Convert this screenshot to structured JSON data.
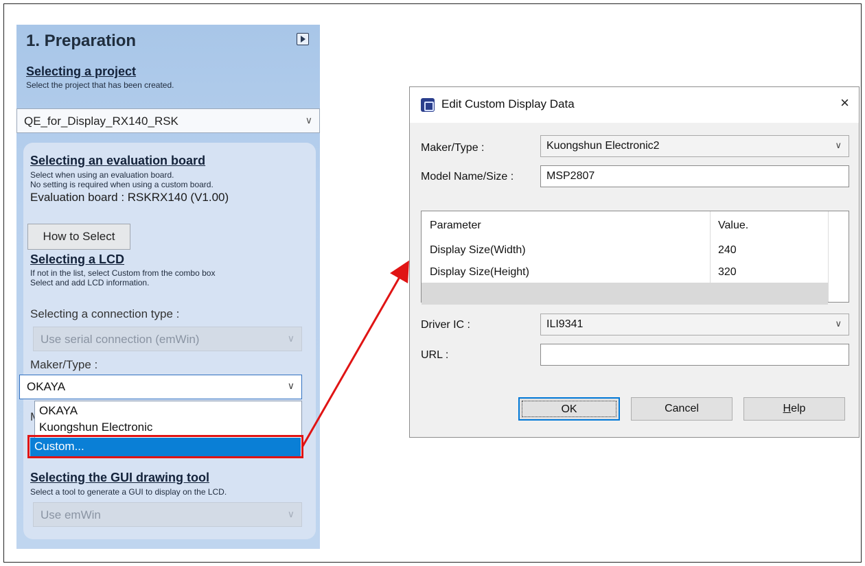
{
  "panel": {
    "title": "1. Preparation",
    "project": {
      "heading": "Selecting a project",
      "description": "Select the project that has been created.",
      "selected": "QE_for_Display_RX140_RSK"
    },
    "board": {
      "heading": "Selecting an evaluation board",
      "description_line1": "Select when using an evaluation board.",
      "description_line2": "No setting is required when using a custom board.",
      "info": "Evaluation board : RSKRX140 (V1.00)",
      "how_to_select": "How to Select"
    },
    "lcd": {
      "heading": "Selecting a LCD",
      "description_line1": "If not in the list, select Custom from the combo box",
      "description_line2": "Select and add LCD information.",
      "connection_label": "Selecting a connection type :",
      "connection_value": "Use serial connection (emWin)",
      "maker_label": "Maker/Type :",
      "maker_value": "OKAYA",
      "dropdown_options": [
        "OKAYA",
        "Kuongshun Electronic",
        "Custom..."
      ],
      "hidden_label_fragment": "M"
    },
    "gui": {
      "heading": "Selecting the GUI drawing tool",
      "description": "Select a tool to generate a GUI to display on the LCD.",
      "value": "Use emWin"
    }
  },
  "dialog": {
    "title": "Edit Custom Display Data",
    "close": "×",
    "maker_label": "Maker/Type :",
    "maker_value": "Kuongshun Electronic2",
    "model_label": "Model Name/Size :",
    "model_value": "MSP2807",
    "table": {
      "headers": [
        "Parameter",
        "Value."
      ],
      "rows": [
        {
          "parameter": "Display Size(Width)",
          "value": "240"
        },
        {
          "parameter": "Display Size(Height)",
          "value": "320"
        }
      ]
    },
    "driver_label": "Driver IC :",
    "driver_value": "ILI9341",
    "url_label": "URL :",
    "url_value": "",
    "buttons": {
      "ok": "OK",
      "cancel": "Cancel",
      "help_underlined": "H",
      "help_rest": "elp"
    }
  },
  "colors": {
    "highlight": "#e01414",
    "selection": "#0a7fd6",
    "arrow": "#e01414"
  }
}
